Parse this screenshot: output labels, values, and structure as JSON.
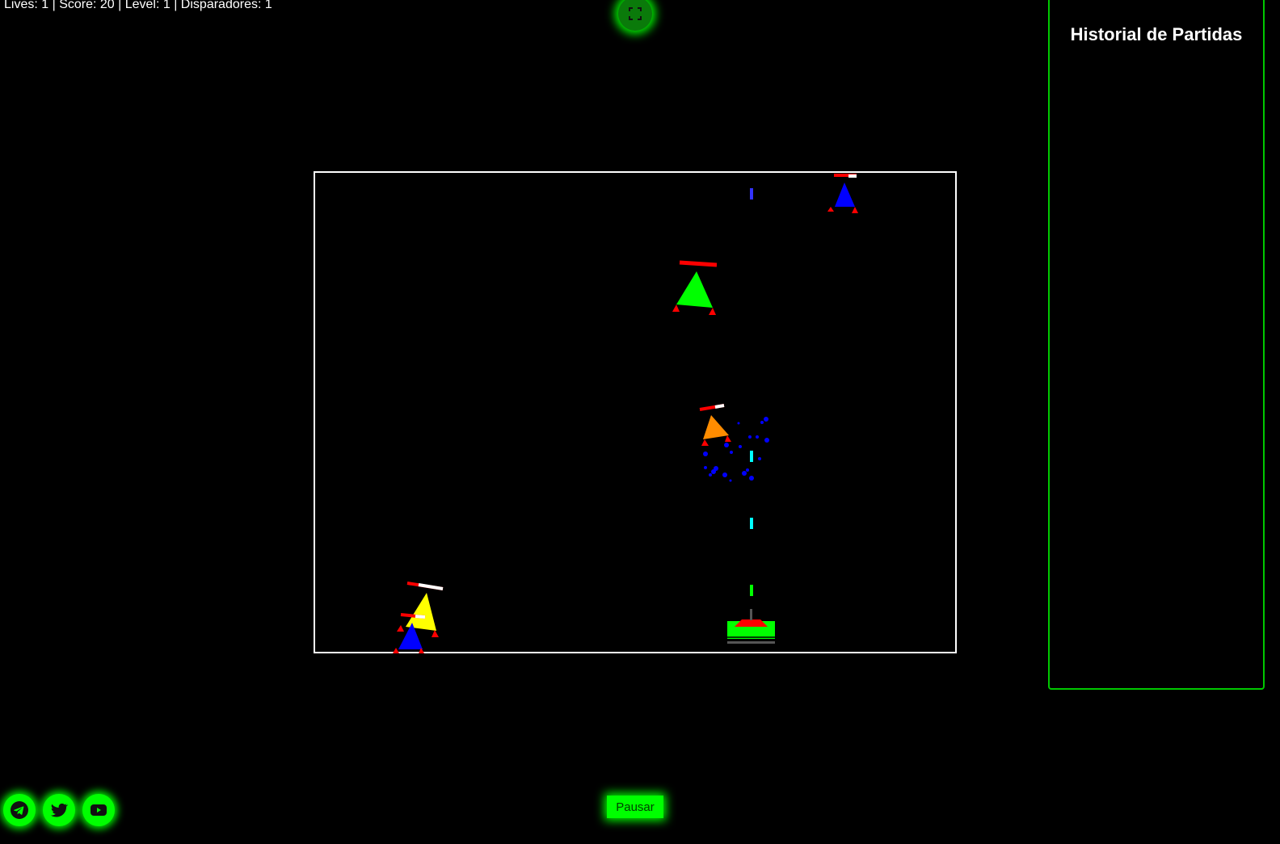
{
  "hud": {
    "text": "Lives: 1 | Score: 20 | Level: 1 | Disparadores: 1"
  },
  "history": {
    "title": "Historial de Partidas"
  },
  "controls": {
    "pause_label": "Pausar"
  },
  "social": [
    "telegram-icon",
    "twitter-icon",
    "youtube-icon"
  ],
  "colors": {
    "accent": "#00ff00",
    "enemy_green": "#00ff00",
    "enemy_blue": "#0000ff",
    "enemy_yellow": "#ffff00",
    "enemy_orange": "#ff8c00",
    "health_bar": "#ff0000",
    "bullet_cyan": "#00ffff"
  }
}
